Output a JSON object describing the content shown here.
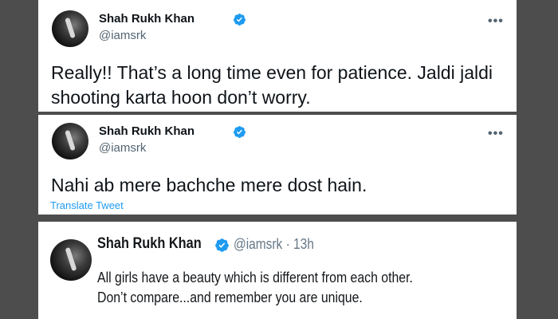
{
  "tweets": [
    {
      "author": "Shah Rukh Khan",
      "handle": "@iamsrk",
      "text": "Really!! That’s a long time even for patience. Jaldi jaldi shooting karta hoon don’t worry.",
      "more_icon": "•••"
    },
    {
      "author": "Shah Rukh Khan",
      "handle": "@iamsrk",
      "text": "Nahi ab mere bachche mere dost hain.",
      "translate_label": "Translate Tweet",
      "more_icon": "•••"
    },
    {
      "author": "Shah Rukh Khan",
      "handle_time": "@iamsrk · 13h",
      "text": "All girls have a beauty which is different from each other. Don’t compare...and remember you are unique."
    }
  ],
  "colors": {
    "verified": "#1d9bf0",
    "link": "#1d9bf0",
    "background": "#4d4d4d"
  },
  "icons": [
    "avatar",
    "verified-badge-icon",
    "more-options-icon"
  ]
}
